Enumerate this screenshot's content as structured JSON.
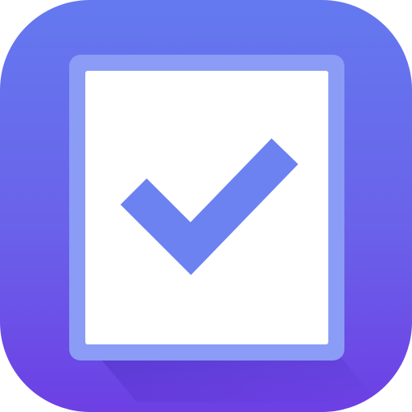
{
  "app_icon": {
    "glyph": "checklist-icon",
    "colors": {
      "background_top": "#6479ef",
      "background_bottom": "#6d3fe4",
      "page_border": "#8a9cf6",
      "page_fill": "#ffffff",
      "checkmark": "#6b82f0"
    }
  }
}
